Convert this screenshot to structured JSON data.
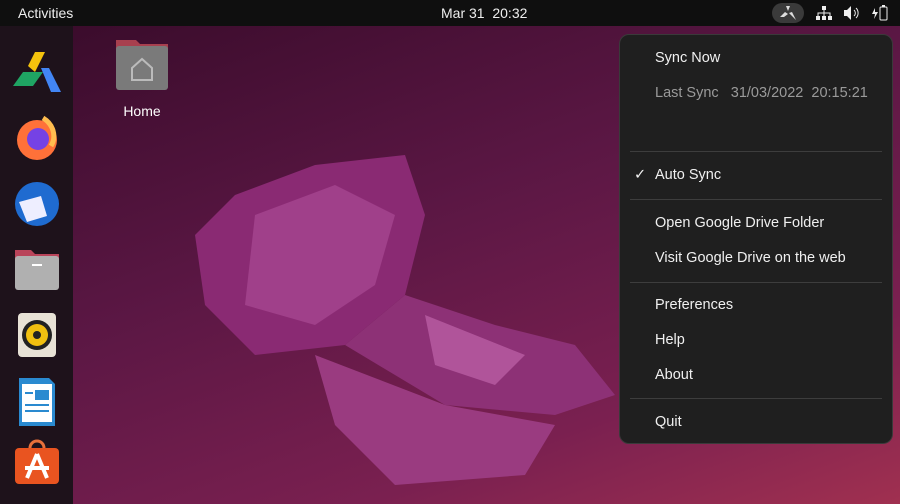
{
  "topbar": {
    "activities": "Activities",
    "date": "Mar 31",
    "time": "20:32",
    "tray_icons": [
      "google-drive-icon",
      "network-icon",
      "volume-icon",
      "battery-charging-icon"
    ]
  },
  "dock": {
    "apps": [
      "google-drive-icon",
      "firefox-icon",
      "thunderbird-icon",
      "files-icon",
      "rhythmbox-icon",
      "libreoffice-writer-icon",
      "app-center-icon"
    ]
  },
  "desktop": {
    "home_label": "Home"
  },
  "menu": {
    "sync_now": "Sync Now",
    "last_sync_label": "Last Sync",
    "last_sync_value": "31/03/2022  20:15:21",
    "auto_sync_check": "✓",
    "auto_sync": "Auto Sync",
    "open_folder": "Open Google Drive Folder",
    "visit_web": "Visit Google Drive on the web",
    "preferences": "Preferences",
    "help": "Help",
    "about": "About",
    "quit": "Quit"
  }
}
